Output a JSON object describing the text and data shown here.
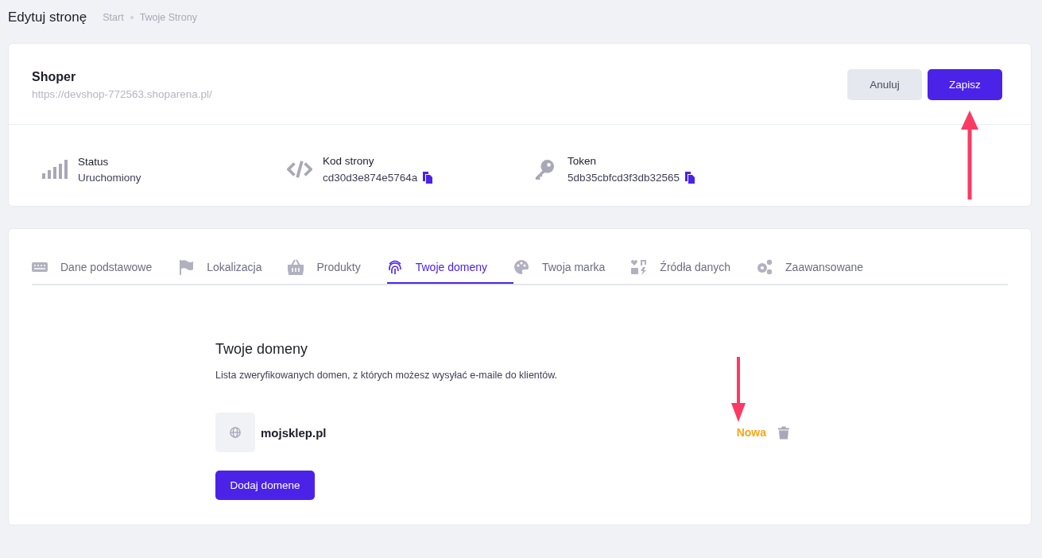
{
  "page_title": "Edytuj stronę",
  "breadcrumbs": [
    "Start",
    "Twoje Strony"
  ],
  "site": {
    "name": "Shoper",
    "url": "https://devshop-772563.shoparena.pl/"
  },
  "buttons": {
    "cancel": "Anuluj",
    "save": "Zapisz"
  },
  "info": [
    {
      "label": "Status",
      "value": "Uruchomiony",
      "copyable": false
    },
    {
      "label": "Kod strony",
      "value": "cd30d3e874e5764a",
      "copyable": true
    },
    {
      "label": "Token",
      "value": "5db35cbfcd3f3db32565",
      "copyable": true
    }
  ],
  "tabs": [
    {
      "label": "Dane podstawowe",
      "selected": false
    },
    {
      "label": "Lokalizacja",
      "selected": false
    },
    {
      "label": "Produkty",
      "selected": false
    },
    {
      "label": "Twoje domeny",
      "selected": true
    },
    {
      "label": "Twoja marka",
      "selected": false
    },
    {
      "label": "Źródła danych",
      "selected": false
    },
    {
      "label": "Zaawansowane",
      "selected": false
    }
  ],
  "section": {
    "title": "Twoje domeny",
    "description": "Lista zweryfikowanych domen, z których możesz wysyłać e-maile do klientów.",
    "domains": [
      {
        "name": "mojsklep.pl",
        "status": "Nowa"
      }
    ],
    "add_button": "Dodaj domene"
  }
}
